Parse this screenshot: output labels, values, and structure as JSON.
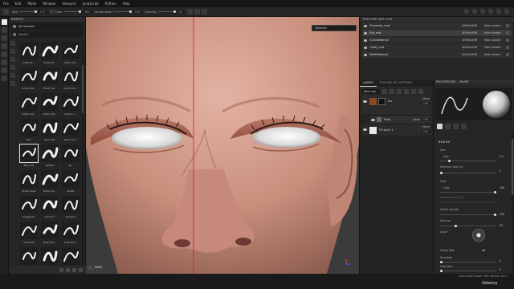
{
  "menu": [
    "File",
    "Edit",
    "Mode",
    "Window",
    "Viewport",
    "JavaScript",
    "Python",
    "Help"
  ],
  "toolbar": {
    "size_label": "Size",
    "size_value": "0.5",
    "flow_label": "Flow",
    "flow_value": "100",
    "stroke_opacity_label": "Stroke opaci",
    "stroke_opacity_value": "100",
    "spacing_label": "Spacing",
    "spacing_value": "25"
  },
  "assets": {
    "title": "ASSETS",
    "library": "All libraries",
    "search_placeholder": "Search",
    "brushes": [
      {
        "label": "Artistic Br..."
      },
      {
        "label": "Artistic Br..."
      },
      {
        "label": "Artistic Hai..."
      },
      {
        "label": "Artistic Hai..."
      },
      {
        "label": "Artistic Hai..."
      },
      {
        "label": "Artistic Hai..."
      },
      {
        "label": "Artistic Soft..."
      },
      {
        "label": "Artistic Soft..."
      },
      {
        "label": "Autumn L..."
      },
      {
        "label": "Bark"
      },
      {
        "label": "Basic Hard"
      },
      {
        "label": "Basic Hard..."
      },
      {
        "label": "Basic Soft"
      },
      {
        "label": "Bubbles"
      },
      {
        "label": "Bur"
      },
      {
        "label": "Broken Glass"
      },
      {
        "label": "Bullet Imp..."
      },
      {
        "label": "Bullets"
      },
      {
        "label": "Calligraphic"
      },
      {
        "label": "Cement 1"
      },
      {
        "label": "Cement 2"
      },
      {
        "label": "Chalk Bold"
      },
      {
        "label": "Chalk Bum..."
      },
      {
        "label": "Chalk Spre..."
      },
      {
        "label": "Chalk Strong"
      },
      {
        "label": "Chalk Thin"
      },
      {
        "label": "Charcoal"
      },
      {
        "label": "Charcoal Fi..."
      },
      {
        "label": "Charcoal M..."
      },
      {
        "label": "Charcoal N..."
      }
    ]
  },
  "viewport": {
    "material_dropdown": "Material",
    "bottom_label": "PAINT"
  },
  "texture_set_list": {
    "title": "TEXTURE SET LIST",
    "rows": [
      {
        "name": "Character_mat",
        "res": "4096x4096",
        "shader": "Main shader"
      },
      {
        "name": "Eye_mat",
        "res": "4096x4096",
        "shader": "Main shader"
      },
      {
        "name": "GumsMaterial",
        "res": "4096x4096",
        "shader": "Main shader"
      },
      {
        "name": "Outfit_mat",
        "res": "4096x4096",
        "shader": "Main shader"
      },
      {
        "name": "TeethMaterial",
        "res": "4096x4096",
        "shader": "Main shader"
      }
    ]
  },
  "layers": {
    "tab_layers": "LAYERS",
    "tab_settings": "TEXTURE SET SETTINGS",
    "channel": "Base colo",
    "items": [
      {
        "name": "Iris",
        "blend": "Norm",
        "opacity": "100"
      },
      {
        "name": "Paint",
        "blend": "Norm",
        "opacity": "100"
      },
      {
        "name": "Fill layer 1",
        "blend": "Norm",
        "opacity": "100"
      }
    ]
  },
  "properties": {
    "title": "PROPERTIES - PAINT",
    "brush_header": "BRUSH",
    "size_label": "Size",
    "size_sub": "Size",
    "size_value": "0.5",
    "min_size_label": "Minimum Size (%)",
    "min_size_value": "0",
    "flow_label": "Flow",
    "flow_sub": "Flow",
    "flow_value": "100",
    "min_flow_label": "Minimum flow (%)",
    "stroke_opacity_label": "Stroke opacity",
    "stroke_opacity_value": "100",
    "spacing_label": "Spacing",
    "spacing_value": "25",
    "angle_label": "Angle",
    "follow_path_label": "Follow Path",
    "follow_path_value": "off",
    "size_jitter_label": "Size Jitter",
    "size_jitter_value": "0",
    "flow_jitter_label": "Flow Jitter",
    "flow_jitter_value": "0"
  },
  "status": {
    "cache": "Cache Disk Usage:",
    "cache_value": "56%",
    "version": "Version: 8.2.1"
  },
  "watermark": "Udemy"
}
